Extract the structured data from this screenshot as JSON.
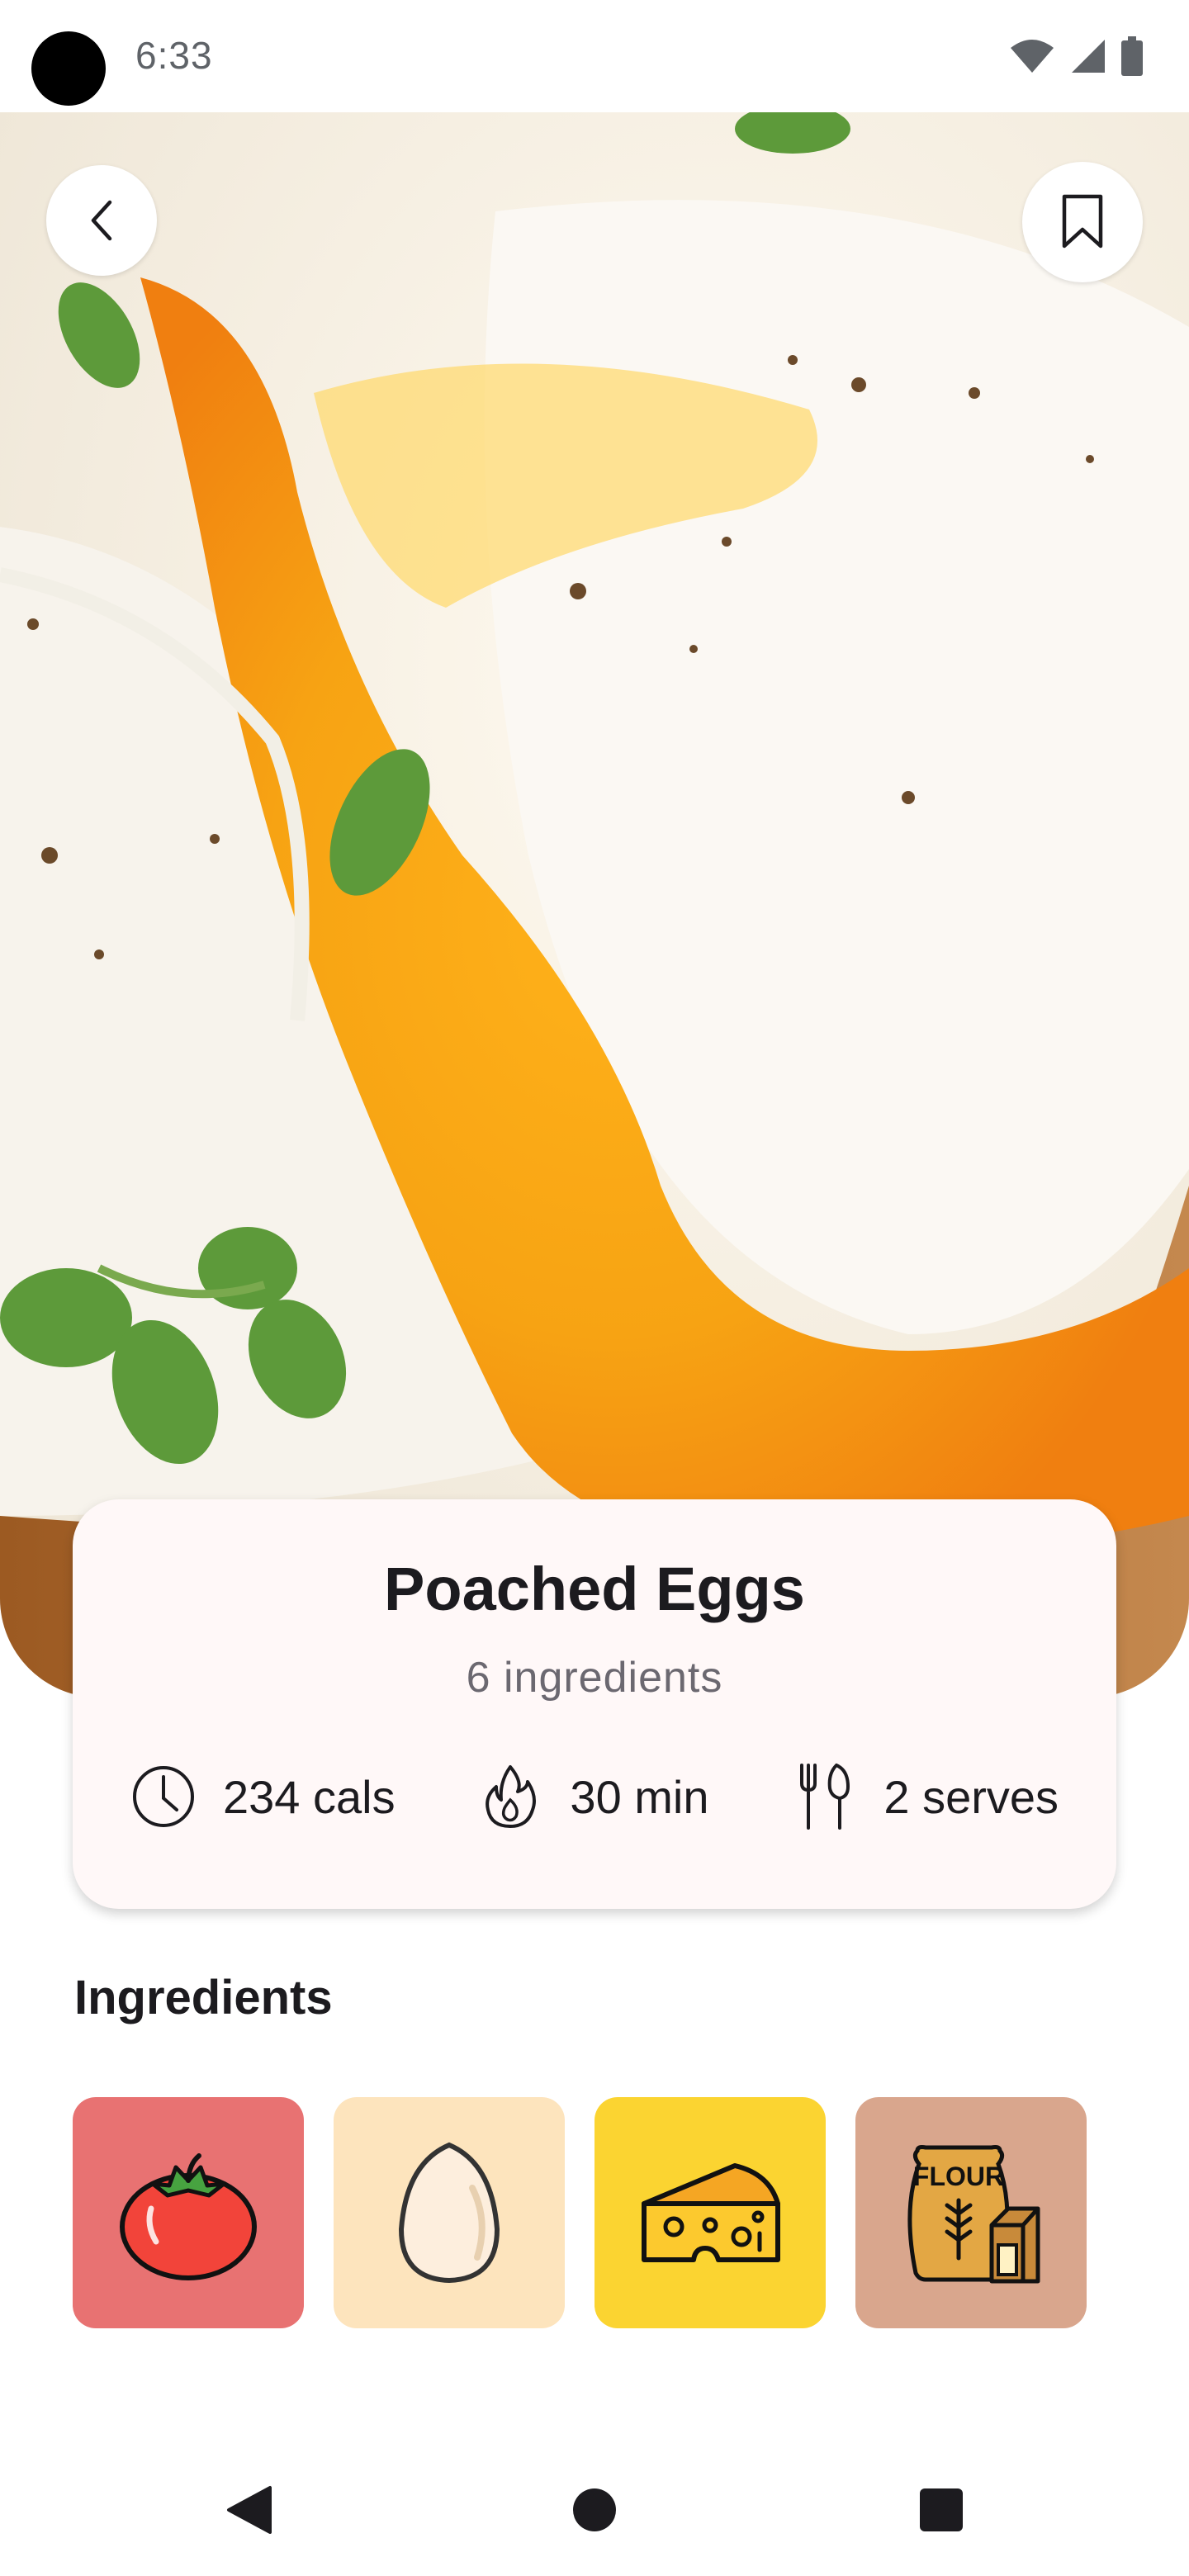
{
  "status_bar": {
    "time": "6:33"
  },
  "hero": {
    "image_alt": "poached-egg-photo"
  },
  "nav": {
    "back_icon": "chevron-left-icon",
    "bookmark_icon": "bookmark-icon"
  },
  "recipe": {
    "title": "Poached Eggs",
    "subtitle": "6 ingredients",
    "stats": [
      {
        "icon": "clock-icon",
        "label": "234 cals"
      },
      {
        "icon": "flame-icon",
        "label": "30 min"
      },
      {
        "icon": "utensils-icon",
        "label": "2 serves"
      }
    ]
  },
  "ingredients_section": {
    "title": "Ingredients",
    "items": [
      {
        "name": "tomato",
        "icon": "tomato-icon",
        "bg": "#e87272"
      },
      {
        "name": "egg",
        "icon": "egg-icon",
        "bg": "#fde4bd"
      },
      {
        "name": "cheese",
        "icon": "cheese-icon",
        "bg": "#fbd431"
      },
      {
        "name": "flour",
        "icon": "flour-icon",
        "bg": "#d9a68d",
        "text": "FLOUR"
      }
    ]
  },
  "system_nav": {
    "back": "triangle-back-icon",
    "home": "circle-home-icon",
    "recents": "square-recents-icon"
  }
}
